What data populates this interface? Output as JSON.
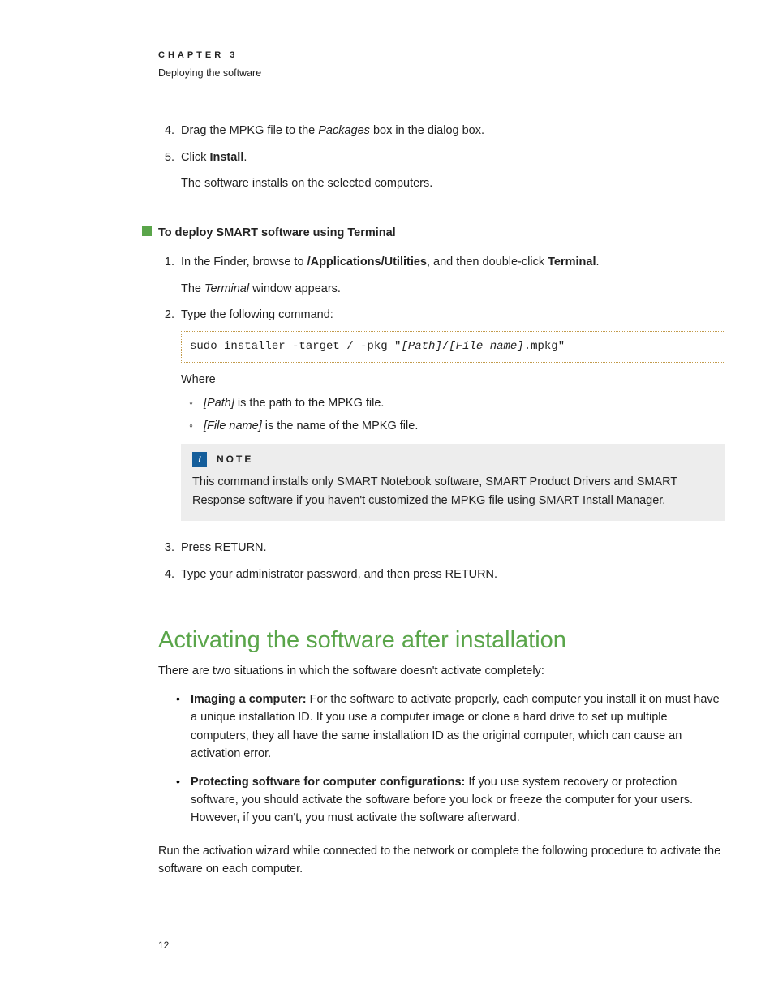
{
  "header": {
    "chapter": "CHAPTER 3",
    "subtitle": "Deploying the software"
  },
  "top_list": {
    "s4": {
      "n": "4.",
      "pre": "Drag the MPKG file to the ",
      "em": "Packages",
      "post": " box in the dialog box."
    },
    "s5": {
      "n": "5.",
      "pre": "Click ",
      "bold": "Install",
      "post": ".",
      "follow": "The software installs on the selected computers."
    }
  },
  "proc": {
    "title": "To deploy SMART software using Terminal",
    "s1": {
      "n": "1.",
      "t1": "In the Finder, browse to ",
      "b1": "/Applications/Utilities",
      "t2": ", and then double-click ",
      "b2": "Terminal",
      "t3": ".",
      "follow_pre": "The ",
      "follow_em": "Terminal",
      "follow_post": " window appears."
    },
    "s2": {
      "n": "2.",
      "text": "Type the following command:",
      "code_a": "sudo installer -target / -pkg \"",
      "code_i1": "[Path]",
      "code_b": "/",
      "code_i2": "[File name]",
      "code_c": ".mpkg\"",
      "where": "Where",
      "sub1_em": "[Path]",
      "sub1_rest": " is the path to the MPKG file.",
      "sub2_em": "[File name]",
      "sub2_rest": " is the name of the MPKG file.",
      "note_label": "NOTE",
      "note_body": "This command installs only SMART Notebook software, SMART Product Drivers and SMART Response software if you haven't customized the MPKG file using SMART Install Manager."
    },
    "s3": {
      "n": "3.",
      "text": "Press RETURN."
    },
    "s4": {
      "n": "4.",
      "text": "Type your administrator password, and then press RETURN."
    }
  },
  "section": {
    "title": "Activating the software after installation",
    "intro": "There are two situations in which the software doesn't activate completely:",
    "b1_bold": "Imaging a computer:",
    "b1_rest": " For the software to activate properly, each computer you install it on must have a unique installation ID. If you use a computer image or clone a hard drive to set up multiple computers, they all have the same installation ID as the original computer, which can cause an activation error.",
    "b2_bold": "Protecting software for computer configurations:",
    "b2_rest": " If you use system recovery or protection software, you should activate the software before you lock or freeze the computer for your users. However, if you can't, you must activate the software afterward.",
    "closing": "Run the activation wizard while connected to the network or complete the following procedure to activate the software on each computer."
  },
  "note_icon_glyph": "i",
  "page_number": "12"
}
